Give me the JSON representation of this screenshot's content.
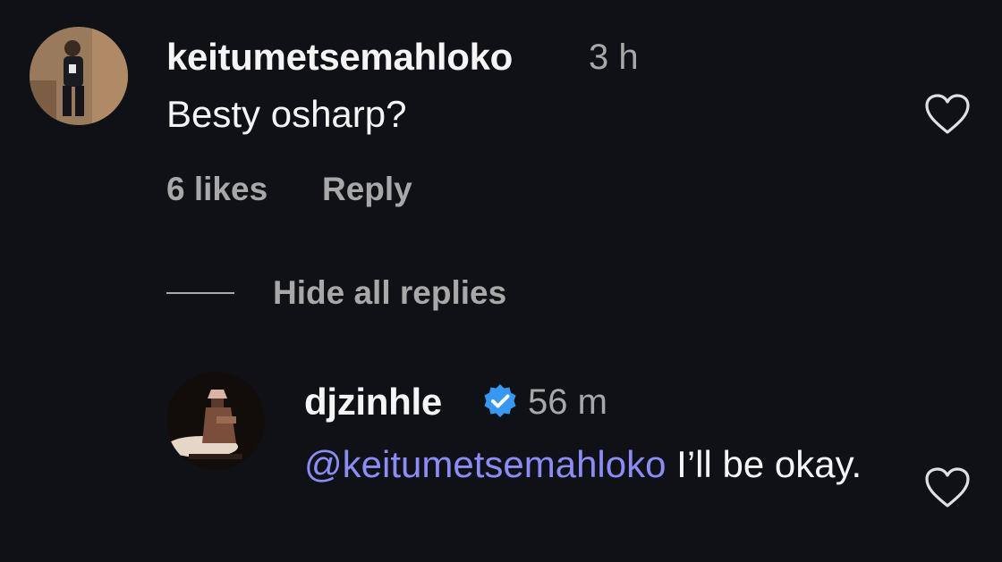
{
  "comments": [
    {
      "username": "keitumetsemahloko",
      "time": "3 h",
      "text": "Besty osharp?",
      "likes": "6 likes",
      "reply_label": "Reply"
    }
  ],
  "replies_toggle": "Hide all replies",
  "reply": {
    "username": "djzinhle",
    "verified": true,
    "time": "56 m",
    "mention": "@keitumetsemahloko",
    "text": " I’ll be okay."
  },
  "icons": {
    "like": "heart-outline-icon",
    "verified": "verified-badge-icon"
  },
  "colors": {
    "background": "#0f1117",
    "mention": "#8c8cf6",
    "verified": "#3897f0",
    "secondary_text": "#a8a8a8"
  }
}
